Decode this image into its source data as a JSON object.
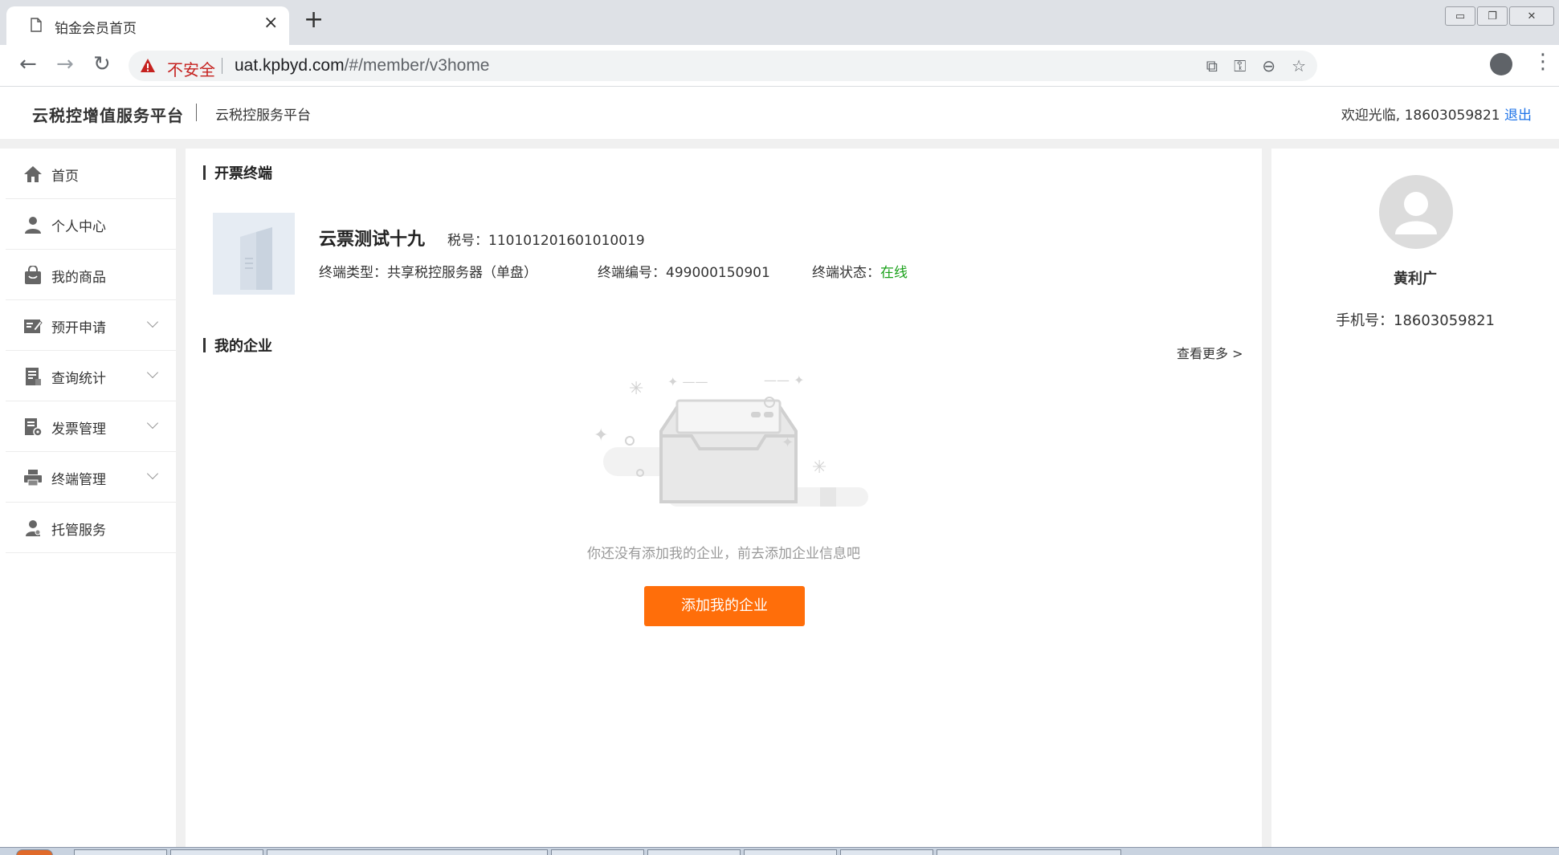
{
  "browser": {
    "tab_title": "铂金会员首页",
    "tab_close": "×",
    "new_tab": "+",
    "security_label": "不安全",
    "url_host": "uat.kpbyd.com",
    "url_path": "/#/member/v3home",
    "window_controls": [
      "▭",
      "❐",
      "✕"
    ]
  },
  "header": {
    "brand": "云税控增值服务平台",
    "brand_sub": "云税控服务平台",
    "welcome_text": "欢迎光临, 18603059821 ",
    "logout": "退出"
  },
  "sidebar": {
    "items": [
      {
        "label": "首页",
        "icon": "home-icon",
        "expandable": false
      },
      {
        "label": "个人中心",
        "icon": "user-icon",
        "expandable": false
      },
      {
        "label": "我的商品",
        "icon": "bag-icon",
        "expandable": false
      },
      {
        "label": "预开申请",
        "icon": "form-icon",
        "expandable": true
      },
      {
        "label": "查询统计",
        "icon": "report-icon",
        "expandable": true
      },
      {
        "label": "发票管理",
        "icon": "invoice-icon",
        "expandable": true
      },
      {
        "label": "终端管理",
        "icon": "printer-icon",
        "expandable": true
      },
      {
        "label": "托管服务",
        "icon": "service-icon",
        "expandable": false
      }
    ]
  },
  "main": {
    "terminal_section": {
      "title": "开票终端",
      "name": "云票测试十九",
      "tax_no": "税号：110101201601010019",
      "type": "终端类型：共享税控服务器（单盘）",
      "number": "终端编号：499000150901",
      "status_label": "终端状态：",
      "status_value": "在线"
    },
    "enterprise_section": {
      "title": "我的企业",
      "view_more": "查看更多 >",
      "empty_text": "你还没有添加我的企业，前去添加企业信息吧",
      "add_button": "添加我的企业"
    }
  },
  "profile": {
    "name": "黄利广",
    "phone": "手机号：18603059821"
  },
  "colors": {
    "accent_orange": "#ff6e0a",
    "online_green": "#1aa11a",
    "link_blue": "#1e73e8",
    "insecure_red": "#c5221f"
  }
}
